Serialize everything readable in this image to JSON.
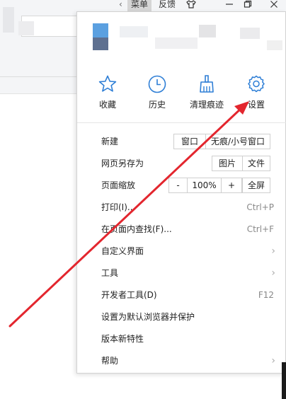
{
  "titlebar": {
    "menu_label": "菜单",
    "feedback_label": "反馈"
  },
  "quick_actions": [
    {
      "label": "收藏",
      "icon": "star-icon"
    },
    {
      "label": "历史",
      "icon": "clock-icon"
    },
    {
      "label": "清理痕迹",
      "icon": "broom-icon"
    },
    {
      "label": "设置",
      "icon": "gear-icon"
    }
  ],
  "menu": {
    "new": {
      "label": "新建",
      "window_btn": "窗口",
      "incognito_btn": "无痕/小号窗口"
    },
    "save_as": {
      "label": "网页另存为",
      "image_btn": "图片",
      "file_btn": "文件"
    },
    "zoom": {
      "label": "页面缩放",
      "minus": "-",
      "value": "100%",
      "plus": "+",
      "fullscreen": "全屏"
    },
    "print": {
      "label": "打印(I)...",
      "shortcut": "Ctrl+P"
    },
    "find": {
      "label": "在页面内查找(F)...",
      "shortcut": "Ctrl+F"
    },
    "customize": {
      "label": "自定义界面"
    },
    "tools": {
      "label": "工具"
    },
    "devtools": {
      "label": "开发者工具(D)",
      "shortcut": "F12"
    },
    "default_browser": {
      "label": "设置为默认浏览器并保护"
    },
    "whats_new": {
      "label": "版本新特性"
    },
    "help": {
      "label": "帮助"
    }
  },
  "colors": {
    "accent_icon": "#2f7fd6",
    "annotation_arrow": "#e3262e"
  }
}
